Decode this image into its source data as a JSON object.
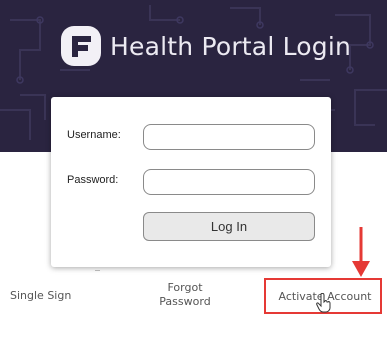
{
  "header": {
    "title": "Health Portal Login",
    "logo_icon": "portal-logo-icon"
  },
  "login_form": {
    "username_label": "Username:",
    "password_label": "Password:",
    "username_value": "",
    "password_value": "",
    "login_button_label": "Log In"
  },
  "footer_links": {
    "single_sign": "Single Sign",
    "forgot_password_line1": "Forgot",
    "forgot_password_line2": "Password",
    "activate_account": "Activate Account"
  },
  "annotations": {
    "highlight_color": "#e53935",
    "arrow_icon": "arrow-down-icon",
    "cursor_icon": "hand-cursor-icon"
  },
  "colors": {
    "hero_background": "#2a2440",
    "card_background": "#ffffff"
  }
}
